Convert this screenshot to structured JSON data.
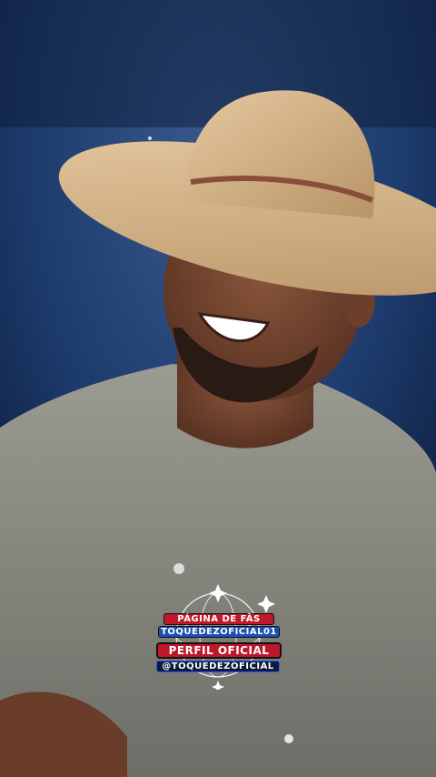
{
  "colors": {
    "sky": "#1c3a6b",
    "shirt": "#8f8f86",
    "hat": "#d6b68d",
    "skin": "#7a4a34",
    "badge_red": "#c0182b",
    "badge_blue": "#1b4fb6"
  },
  "badge": {
    "line1": "PÁGINA DE FÃS",
    "line2": "TOQUEDEZOFICIAL01",
    "line3": "PERFIL OFICIAL",
    "line4": "@TOQUEDEZOFICIAL"
  }
}
